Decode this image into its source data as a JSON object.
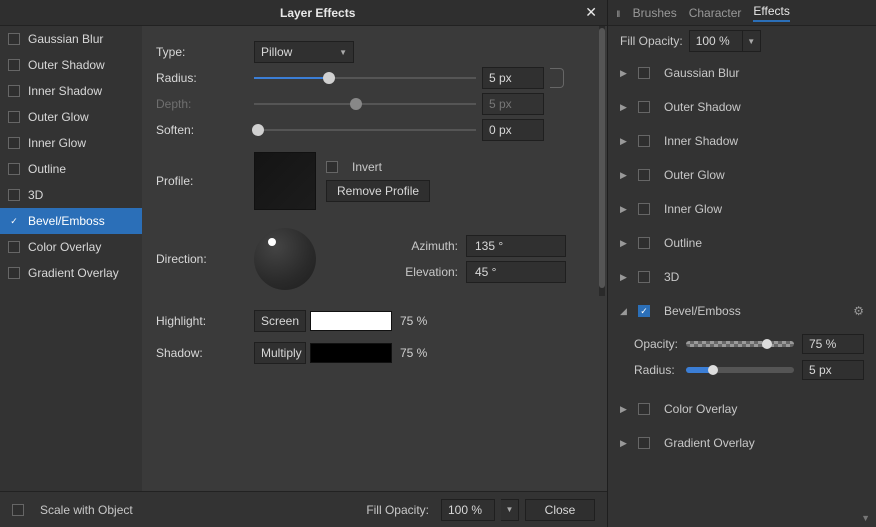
{
  "dialog": {
    "title": "Layer Effects",
    "effects": [
      {
        "name": "Gaussian Blur",
        "checked": false,
        "selected": false
      },
      {
        "name": "Outer Shadow",
        "checked": false,
        "selected": false
      },
      {
        "name": "Inner Shadow",
        "checked": false,
        "selected": false
      },
      {
        "name": "Outer Glow",
        "checked": false,
        "selected": false
      },
      {
        "name": "Inner Glow",
        "checked": false,
        "selected": false
      },
      {
        "name": "Outline",
        "checked": false,
        "selected": false
      },
      {
        "name": "3D",
        "checked": false,
        "selected": false
      },
      {
        "name": "Bevel/Emboss",
        "checked": true,
        "selected": true
      },
      {
        "name": "Color Overlay",
        "checked": false,
        "selected": false
      },
      {
        "name": "Gradient Overlay",
        "checked": false,
        "selected": false
      }
    ],
    "config": {
      "type_label": "Type:",
      "type_value": "Pillow",
      "radius_label": "Radius:",
      "radius_value": "5 px",
      "radius_percent": 34,
      "depth_label": "Depth:",
      "depth_value": "5 px",
      "depth_percent": 46,
      "depth_enabled": false,
      "soften_label": "Soften:",
      "soften_value": "0 px",
      "soften_percent": 0,
      "profile_label": "Profile:",
      "invert_label": "Invert",
      "remove_profile_label": "Remove Profile",
      "direction_label": "Direction:",
      "azimuth_label": "Azimuth:",
      "azimuth_value": "135 °",
      "elevation_label": "Elevation:",
      "elevation_value": "45 °",
      "highlight_label": "Highlight:",
      "highlight_blend": "Screen",
      "highlight_color": "#ffffff",
      "highlight_opacity": "75 %",
      "shadow_label": "Shadow:",
      "shadow_blend": "Multiply",
      "shadow_color": "#000000",
      "shadow_opacity": "75 %"
    },
    "footer": {
      "scale_label": "Scale with Object",
      "fill_opacity_label": "Fill Opacity:",
      "fill_opacity_value": "100 %",
      "close_label": "Close"
    }
  },
  "panel": {
    "tabs": {
      "brushes": "Brushes",
      "character": "Character",
      "effects": "Effects"
    },
    "fill_opacity_label": "Fill Opacity:",
    "fill_opacity_value": "100 %",
    "items": [
      {
        "name": "Gaussian Blur",
        "checked": false,
        "expanded": false
      },
      {
        "name": "Outer Shadow",
        "checked": false,
        "expanded": false
      },
      {
        "name": "Inner Shadow",
        "checked": false,
        "expanded": false
      },
      {
        "name": "Outer Glow",
        "checked": false,
        "expanded": false
      },
      {
        "name": "Inner Glow",
        "checked": false,
        "expanded": false
      },
      {
        "name": "Outline",
        "checked": false,
        "expanded": false
      },
      {
        "name": "3D",
        "checked": false,
        "expanded": false
      },
      {
        "name": "Bevel/Emboss",
        "checked": true,
        "expanded": true,
        "opacity_label": "Opacity:",
        "opacity_value": "75 %",
        "opacity_percent": 75,
        "radius_label": "Radius:",
        "radius_value": "5 px",
        "radius_percent": 25
      },
      {
        "name": "Color Overlay",
        "checked": false,
        "expanded": false
      },
      {
        "name": "Gradient Overlay",
        "checked": false,
        "expanded": false
      }
    ]
  }
}
